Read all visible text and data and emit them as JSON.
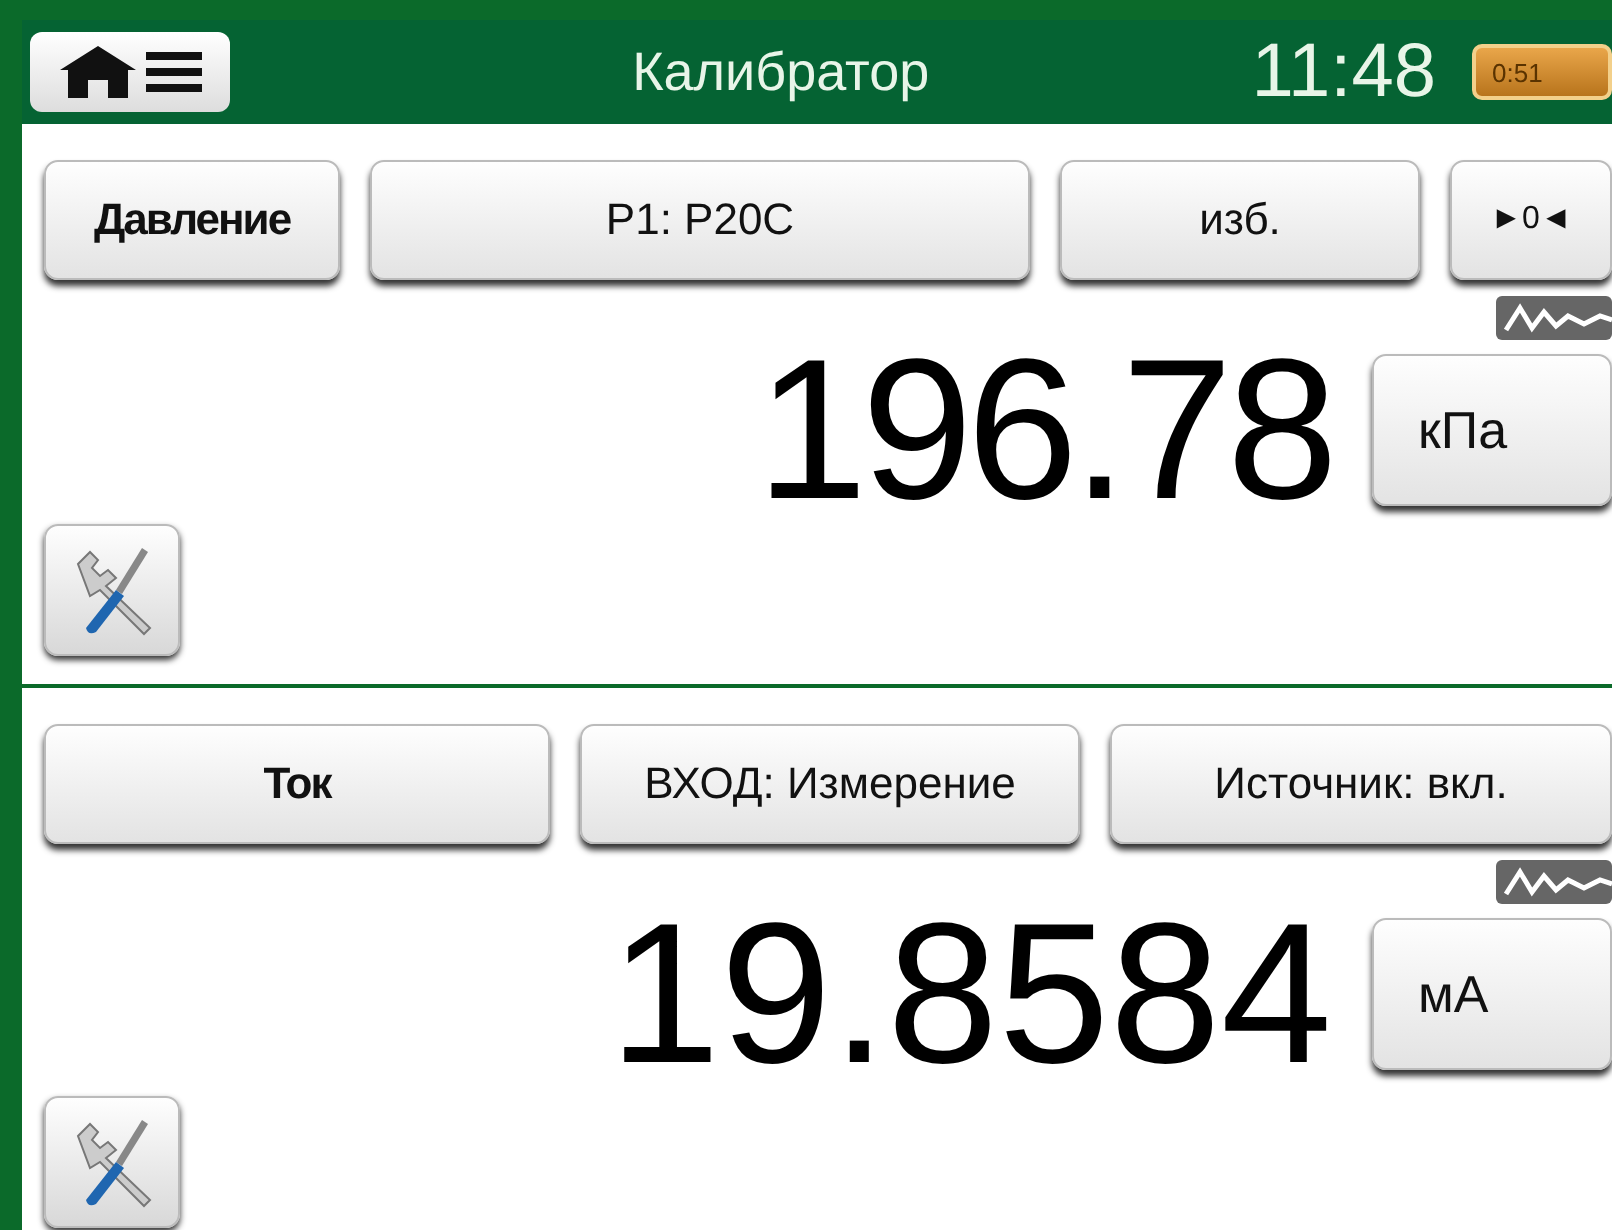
{
  "header": {
    "title": "Калибратор",
    "time": "11:48",
    "battery": "0:51"
  },
  "panels": [
    {
      "buttons": [
        {
          "label": "Давление",
          "kind": "quantity"
        },
        {
          "label": "P1: P20C",
          "kind": "option"
        },
        {
          "label": "изб.",
          "kind": "option"
        },
        {
          "label": "►0◄",
          "kind": "small"
        }
      ],
      "value": "196.78",
      "unit": "кПа"
    },
    {
      "buttons": [
        {
          "label": "Ток",
          "kind": "quantity"
        },
        {
          "label": "ВХОД: Измерение",
          "kind": "option"
        },
        {
          "label": "Источник: вкл.",
          "kind": "option"
        }
      ],
      "value": "19.8584",
      "unit": "мА"
    }
  ]
}
